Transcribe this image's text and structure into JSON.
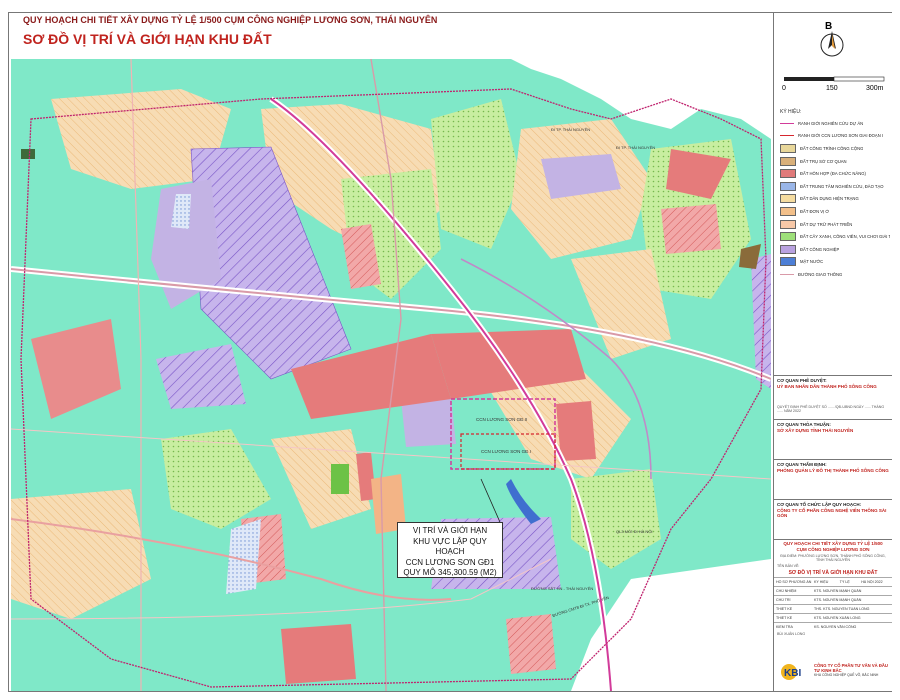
{
  "header": {
    "title_line1": "QUY HOẠCH CHI TIẾT XÂY DỰNG TỶ LỆ 1/500 CỤM CÔNG NGHIỆP LƯƠNG SƠN, THÁI NGUYÊN",
    "title_line2": "SƠ ĐỒ VỊ TRÍ VÀ GIỚI HẠN KHU ĐẤT"
  },
  "compass": {
    "north_label": "B"
  },
  "scale_bar": {
    "labels": [
      "0",
      "150",
      "300m"
    ]
  },
  "legend": {
    "title": "KÝ HIỆU:",
    "items": [
      {
        "label": "RANH GIỚI NGHIÊN CỨU DỰ ÁN",
        "kind": "line",
        "color": "#d23b9a"
      },
      {
        "label": "RANH GIỚI CCN LƯƠNG SƠN GIAI ĐOẠN I",
        "kind": "line",
        "color": "#d6262e"
      },
      {
        "label": "ĐẤT CÔNG TRÌNH CÔNG CỘNG",
        "kind": "fill",
        "color": "#e8d79a"
      },
      {
        "label": "ĐẤT TRỤ SỞ CƠ QUAN",
        "kind": "fill",
        "color": "#d9b07a"
      },
      {
        "label": "ĐẤT HỖN HỢP (ĐA CHỨC NĂNG)",
        "kind": "fill",
        "color": "#e07a7a"
      },
      {
        "label": "ĐẤT TRUNG TÂM NGHIÊN CỨU, ĐÀO TẠO",
        "kind": "fill",
        "color": "#9ab6e8"
      },
      {
        "label": "ĐẤT DÂN DỤNG HIỆN TRẠNG",
        "kind": "fill",
        "color": "#f5dca0"
      },
      {
        "label": "ĐẤT ĐƠN VỊ Ở",
        "kind": "fill",
        "color": "#f3c08a"
      },
      {
        "label": "ĐẤT DỰ TRỮ PHÁT TRIỂN",
        "kind": "fill",
        "color": "#f7c8a8"
      },
      {
        "label": "ĐẤT CÂY XANH, CÔNG VIÊN, VUI CHƠI GIẢI TRÍ",
        "kind": "fill",
        "color": "#9ee07a"
      },
      {
        "label": "ĐẤT CÔNG NGHIỆP",
        "kind": "fill",
        "color": "#b9a2e0"
      },
      {
        "label": "MẶT NƯỚC",
        "kind": "fill",
        "color": "#4d7fd6"
      },
      {
        "label": "ĐƯỜNG GIAO THÔNG",
        "kind": "line",
        "color": "#d99aa8"
      }
    ]
  },
  "approval": {
    "approve_head": "CƠ QUAN PHÊ DUYỆT:",
    "approve_val": "UỶ BAN NHÂN DÂN THÀNH PHỐ SÔNG CÔNG",
    "approve_note": "QUYẾT ĐỊNH PHÊ DUYỆT SỐ ...... /QĐ-UBND NGÀY ...... THÁNG ...... NĂM 2022",
    "review_head": "CƠ QUAN THỎA THUẬN:",
    "review_val": "SỞ XÂY DỰNG TỈNH THÁI NGUYÊN",
    "appraise_head": "CƠ QUAN THẨM ĐỊNH:",
    "appraise_val": "PHÒNG QUẢN LÝ ĐÔ THỊ THÀNH PHỐ SÔNG CÔNG",
    "org_head": "CƠ QUAN TỔ CHỨC LẬP QUY HOẠCH:",
    "org_val": "CÔNG TY CỔ PHẦN CÔNG NGHỆ VIỄN THÔNG SÀI GÒN"
  },
  "project": {
    "name": "QUY HOẠCH CHI TIẾT XÂY DỰNG TỶ LỆ 1/500",
    "name2": "CỤM CÔNG NGHIỆP LƯƠNG SƠN",
    "place": "ĐỊA ĐIỂM: PHƯỜNG LƯƠNG SƠN, THÀNH PHỐ SÔNG CÔNG, TỈNH THÁI NGUYÊN",
    "drawing_label": "TÊN BẢN VẼ:",
    "drawing_name": "SƠ ĐỒ VỊ TRÍ VÀ GIỚI HẠN KHU ĐẤT",
    "rows": [
      [
        "HỒ SƠ PHƯƠNG ÁN HỒ SƠ",
        "KÝ HIỆU",
        "TỶ LỆ",
        "HÀ NỘI 2022"
      ],
      [
        "CHỦ NHIỆM",
        "KTS. NGUYỄN MẠNH QUÂN"
      ],
      [
        "CHỦ TRÌ",
        "KTS. NGUYỄN MẠNH QUÂN"
      ],
      [
        "THIẾT KẾ",
        "THS. KTS. NGUYỄN TUẤN LONG"
      ],
      [
        "THIẾT KẾ",
        "KTS. NGUYỄN XUÂN LONG"
      ],
      [
        "KIỂM TRA",
        "KS. NGUYỄN VĂN CÔNG"
      ]
    ],
    "sign_label": "BÙI XUÂN LONG"
  },
  "company": {
    "logo_text": "KBI",
    "name": "CÔNG TY CỔ PHẦN TƯ VẤN VÀ ĐẦU TƯ KINH BẮC",
    "address": "KHU CÔNG NGHIỆP QUẾ VÕ, BẮC NINH"
  },
  "map": {
    "callout": {
      "line1": "VỊ TRÍ VÀ GIỚI HẠN",
      "line2": "KHU VỰC LẬP QUY HOẠCH",
      "line3": "CCN LƯƠNG SƠN GĐ1",
      "line4": "QUY MÔ 345,300.59 (M2)"
    },
    "ccn_label_1": "CCN LƯƠNG SƠN GĐ.II",
    "ccn_label_2": "CCN LƯƠNG SƠN GĐ.I",
    "road_labels": {
      "thai_nguyen_1": "ĐI TP. THÁI NGUYÊN",
      "thai_nguyen_2": "ĐI TP. THÁI NGUYÊN",
      "ha_noi_1": "QL3 MỚI ĐI HÀ NỘI",
      "ha_noi_2": "QL3 CŨ ĐI HÀ NỘI",
      "road_thai_nguyen": "ĐƯỜNG SẮT HN - THÁI NGUYÊN",
      "road_pho_yen": "ĐƯỜNG CMT8 ĐI TX. PHỔ YÊN"
    }
  }
}
